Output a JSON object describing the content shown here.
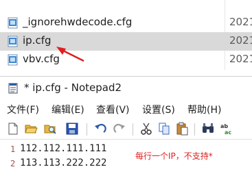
{
  "explorer": {
    "files": [
      {
        "name": "_ignorehwdecode.cfg",
        "date": "2021",
        "selected": false
      },
      {
        "name": "ip.cfg",
        "date": "2021",
        "selected": true
      },
      {
        "name": "vbv.cfg",
        "date": "2021",
        "selected": false
      }
    ]
  },
  "notepad": {
    "title": "* ip.cfg - Notepad2",
    "menu": [
      "文件(F)",
      "编辑(E)",
      "查看(V)",
      "设置(S)",
      "帮助(H)"
    ],
    "lines": [
      {
        "number": "1",
        "text": "112.112.111.111"
      },
      {
        "number": "2",
        "text": "113.113.222.222"
      }
    ],
    "annotation": "每行一个IP，不支持*"
  },
  "colors": {
    "selection": "#d9d9d9",
    "annotation": "#e02020",
    "arrow": "#e02020"
  }
}
